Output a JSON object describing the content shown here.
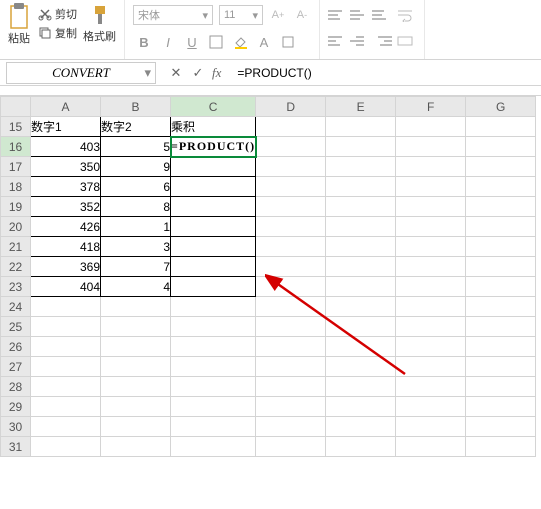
{
  "ribbon": {
    "paste_label": "粘贴",
    "cut_label": "剪切",
    "copy_label": "复制",
    "format_painter_label": "格式刷",
    "font_name": "宋体",
    "font_size": "11",
    "bold": "B",
    "italic": "I",
    "underline": "U"
  },
  "formula_bar": {
    "name_box": "CONVERT",
    "fx": "fx",
    "formula": "=PRODUCT()"
  },
  "columns": [
    "A",
    "B",
    "C",
    "D",
    "E",
    "F",
    "G"
  ],
  "active_col": "C",
  "active_row": "16",
  "rows": [
    {
      "n": "15",
      "a": "数字1",
      "b": "数字2",
      "c": "乘积",
      "header": true
    },
    {
      "n": "16",
      "a": "403",
      "b": "5",
      "c": "=PRODUCT()",
      "formula": true
    },
    {
      "n": "17",
      "a": "350",
      "b": "9",
      "c": ""
    },
    {
      "n": "18",
      "a": "378",
      "b": "6",
      "c": ""
    },
    {
      "n": "19",
      "a": "352",
      "b": "8",
      "c": ""
    },
    {
      "n": "20",
      "a": "426",
      "b": "1",
      "c": ""
    },
    {
      "n": "21",
      "a": "418",
      "b": "3",
      "c": ""
    },
    {
      "n": "22",
      "a": "369",
      "b": "7",
      "c": ""
    },
    {
      "n": "23",
      "a": "404",
      "b": "4",
      "c": ""
    }
  ],
  "empty_rows": [
    "24",
    "25",
    "26",
    "27",
    "28",
    "29",
    "30",
    "31"
  ]
}
